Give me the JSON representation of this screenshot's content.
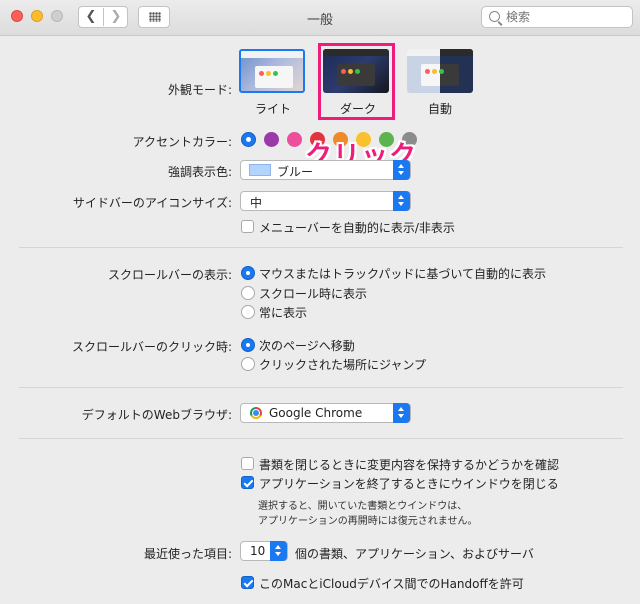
{
  "window": {
    "title": "一般"
  },
  "search": {
    "placeholder": "検索"
  },
  "appearance": {
    "label": "外観モード:",
    "options": [
      {
        "label": "ライト"
      },
      {
        "label": "ダーク",
        "selected": true
      },
      {
        "label": "自動"
      }
    ]
  },
  "accent": {
    "label": "アクセントカラー:",
    "colors": [
      "#1a78f0",
      "#9a3aa8",
      "#ec4f9c",
      "#e0353e",
      "#f1892b",
      "#f8c12d",
      "#5db34d",
      "#8c8c8c"
    ],
    "selected_index": 0
  },
  "annotation": {
    "text": "クリック",
    "color": "#ee1c7a"
  },
  "highlight": {
    "label": "強調表示色:",
    "value": "ブルー",
    "swatch_color": "#b3d4fc"
  },
  "sidebar_icon": {
    "label": "サイドバーのアイコンサイズ:",
    "value": "中",
    "menubar_checkbox": {
      "label": "メニューバーを自動的に表示/非表示",
      "checked": false
    }
  },
  "scrollbar_show": {
    "label": "スクロールバーの表示:",
    "options": [
      {
        "label": "マウスまたはトラックパッドに基づいて自動的に表示",
        "selected": true
      },
      {
        "label": "スクロール時に表示",
        "selected": false
      },
      {
        "label": "常に表示",
        "selected": false
      }
    ]
  },
  "scrollbar_click": {
    "label": "スクロールバーのクリック時:",
    "options": [
      {
        "label": "次のページへ移動",
        "selected": true
      },
      {
        "label": "クリックされた場所にジャンプ",
        "selected": false
      }
    ]
  },
  "browser": {
    "label": "デフォルトのWebブラウザ:",
    "value": "Google Chrome",
    "icon": "chrome-icon"
  },
  "documents": {
    "ask_keep_changes": {
      "label": "書類を閉じるときに変更内容を保持するかどうかを確認",
      "checked": false
    },
    "close_windows": {
      "label": "アプリケーションを終了するときにウインドウを閉じる",
      "checked": true
    },
    "note_line1": "選択すると、開いていた書類とウインドウは、",
    "note_line2": "アプリケーションの再開時には復元されません。"
  },
  "recent": {
    "label": "最近使った項目:",
    "value": "10",
    "suffix": "個の書類、アプリケーション、およびサーバ"
  },
  "handoff": {
    "label": "このMacとiCloudデバイス間でのHandoffを許可",
    "checked": true
  }
}
